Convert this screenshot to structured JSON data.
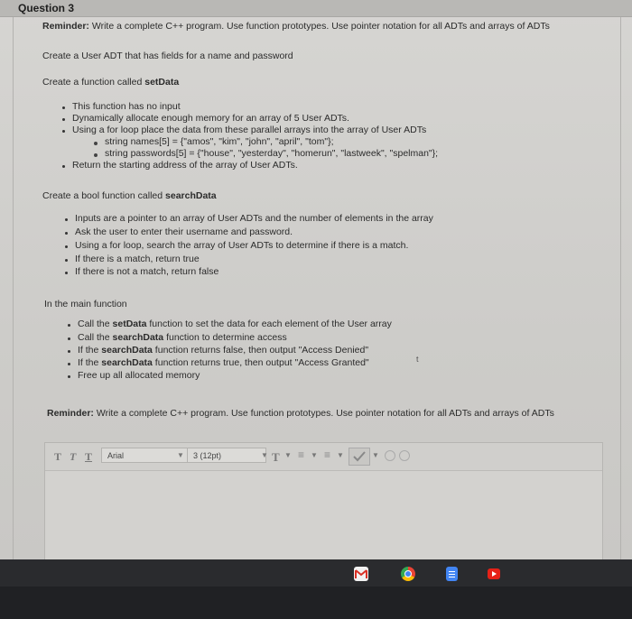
{
  "question": {
    "title": "Question 3"
  },
  "reminder_top": {
    "label": "Reminder:",
    "text": "Write a complete C++ program. Use function prototypes. Use pointer notation for all ADTs and arrays of ADTs"
  },
  "create_user": "Create a User ADT that has fields for a name and password",
  "setdata": {
    "prefix": "Create a function called ",
    "name": "setData",
    "bullets": [
      "This function has no input",
      "Dynamically allocate enough memory for an array of 5 User ADTs.",
      "Using a for loop place the data from these parallel arrays into the array of User ADTs"
    ],
    "subbullets": [
      "string names[5] = {\"amos\", \"kim\", \"john\", \"april\", \"tom\"};",
      "string passwords[5] = {\"house\", \"yesterday\", \"homerun\", \"lastweek\", \"spelman\"};"
    ],
    "last_bullet": "Return the starting address of the array of User ADTs."
  },
  "searchdata": {
    "prefix": "Create a bool function called ",
    "name": "searchData",
    "bullets": [
      "Inputs are a pointer to an array of User ADTs and the number of elements in the array",
      "Ask the user to enter their username and password.",
      "Using a for loop, search the array of User ADTs to determine if there is a match.",
      "If there is a match, return true",
      "If there is not a match, return false"
    ]
  },
  "main": {
    "heading": "In the main function",
    "b1_pre": "Call the ",
    "b1_bold": "setData",
    "b1_post": " function to set the data for each element of the User array",
    "b2_pre": "Call the ",
    "b2_bold": "searchData",
    "b2_post": " function to determine access",
    "b3_pre": "If the ",
    "b3_bold": "searchData",
    "b3_post": " function returns false, then output \"Access Denied\"",
    "b4_pre": "If the ",
    "b4_bold": "searchData",
    "b4_post": " function returns true, then output \"Access Granted\"",
    "b5": "Free up all allocated memory"
  },
  "reminder_bottom": {
    "label": "Reminder:",
    "text": "Write a complete C++ program. Use function prototypes. Use pointer notation for all ADTs and arrays of ADTs"
  },
  "editor": {
    "format_buttons": [
      "T",
      "T",
      "T"
    ],
    "font_family": "Arial",
    "font_size": "3 (12pt)",
    "text_color_label": "T"
  },
  "stray_mark": "t",
  "shelf": {
    "apps": [
      "gmail-icon",
      "chrome-icon",
      "docs-icon",
      "youtube-icon"
    ],
    "colors": {
      "gmail": "#ffffff",
      "chrome": "#4285f4",
      "docs": "#4285f4",
      "youtube": "#e62117"
    }
  }
}
